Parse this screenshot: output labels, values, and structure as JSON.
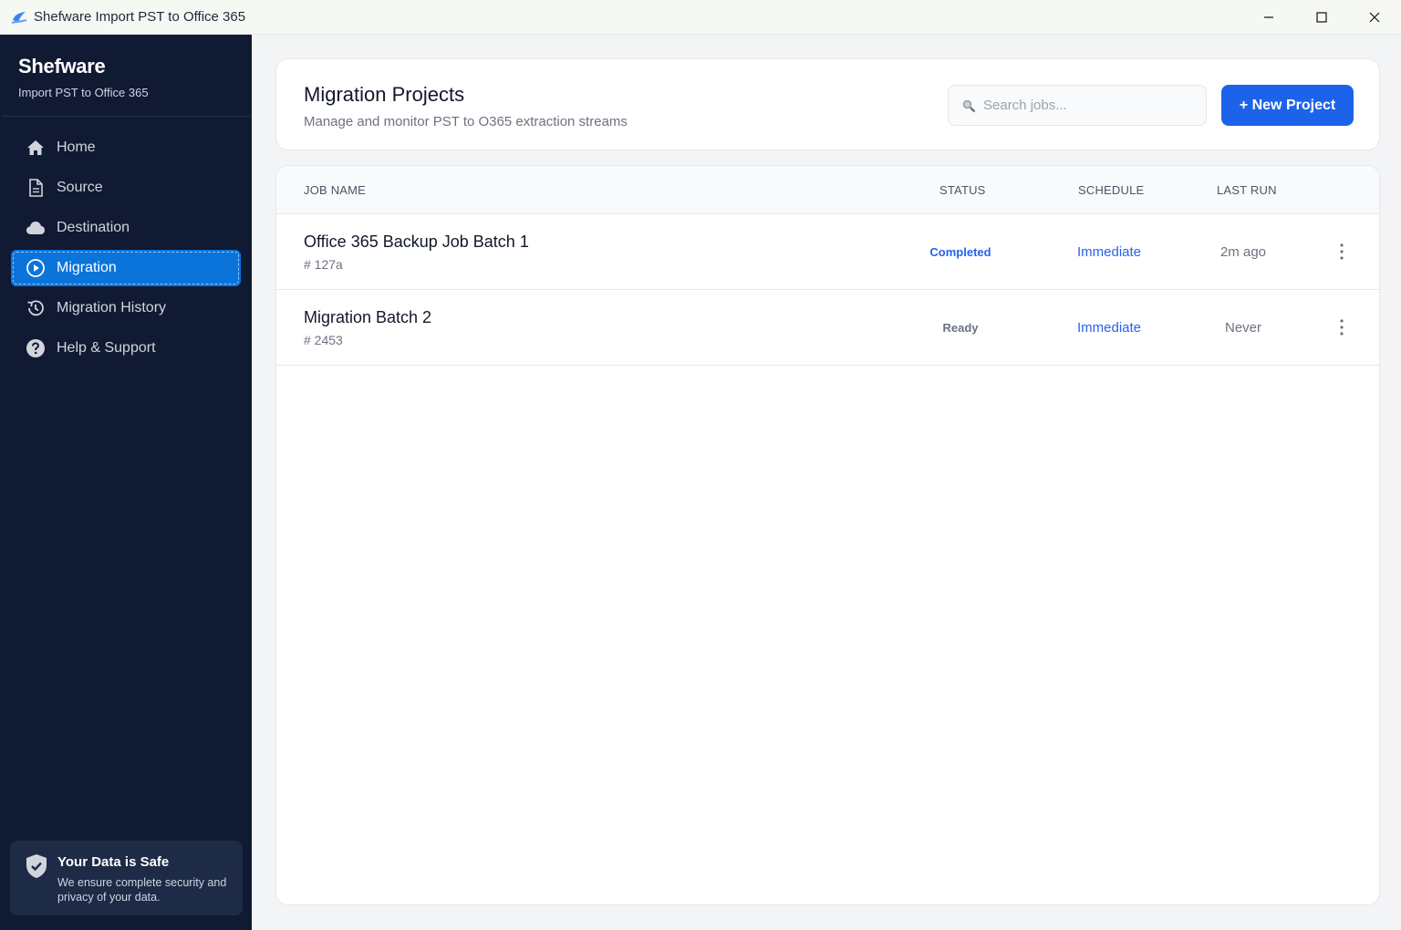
{
  "window": {
    "title": "Shefware Import PST to Office 365",
    "controls": [
      "minimize-icon",
      "maximize-icon",
      "close-icon"
    ]
  },
  "sidebar": {
    "brand": "Shefware",
    "brand_sub": "Import PST to Office 365",
    "items": [
      {
        "label": "Home",
        "icon": "home-icon"
      },
      {
        "label": "Source",
        "icon": "document-icon"
      },
      {
        "label": "Destination",
        "icon": "cloud-icon"
      },
      {
        "label": "Migration",
        "icon": "play-circle-icon",
        "active": true
      },
      {
        "label": "Migration History",
        "icon": "history-icon"
      },
      {
        "label": "Help & Support",
        "icon": "help-icon"
      }
    ],
    "safe_card": {
      "title": "Your Data is Safe",
      "desc_line1": "We ensure complete security and",
      "desc_line2": "privacy of your data."
    }
  },
  "header": {
    "title": "Migration Projects",
    "subtitle": "Manage and monitor PST to O365 extraction streams",
    "search_placeholder": "Search jobs...",
    "new_button": "+ New Project"
  },
  "table": {
    "columns": [
      "JOB NAME",
      "STATUS",
      "SCHEDULE",
      "LAST RUN"
    ],
    "rows": [
      {
        "name": "Office 365 Backup Job Batch 1",
        "id": "# 127a",
        "status": "Completed",
        "schedule": "Immediate",
        "last_run": "2m ago"
      },
      {
        "name": "Migration Batch 2",
        "id": "# 2453",
        "status": "Ready",
        "schedule": "Immediate",
        "last_run": "Never"
      }
    ]
  },
  "colors": {
    "sidebar_bg": "#101a33",
    "accent": "#1d63ea",
    "active_nav": "#0b74da",
    "status_completed": "#2563eb",
    "status_ready": "#6b7280"
  }
}
